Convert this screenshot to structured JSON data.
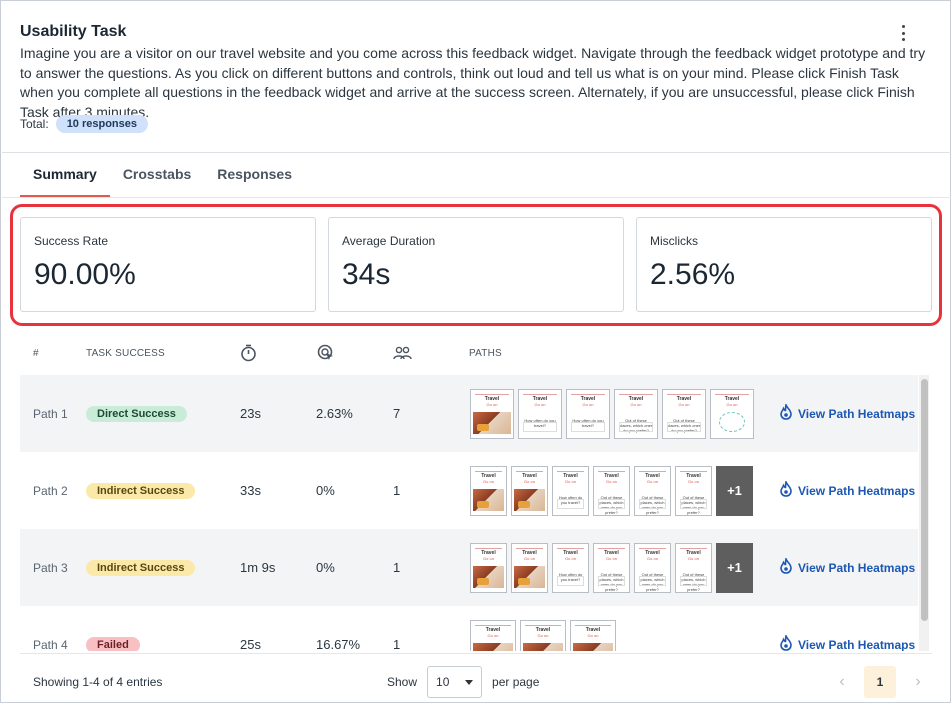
{
  "task": {
    "title": "Usability Task",
    "description": "Imagine you are a visitor on our travel website and you come across this feedback widget. Navigate through the feedback widget prototype and try to answer the questions. As you click on different buttons and controls, think out loud and tell us what is on your mind. Please click Finish Task when you complete all questions in the feedback widget and arrive at the success screen. Alternately, if you are unsuccessful, please click Finish Task after 3 minutes.",
    "total_label": "Total:",
    "responses_badge": "10 responses"
  },
  "tabs": [
    "Summary",
    "Crosstabs",
    "Responses"
  ],
  "active_tab": "Summary",
  "metrics": [
    {
      "label": "Success Rate",
      "value": "90.00%"
    },
    {
      "label": "Average Duration",
      "value": "34s"
    },
    {
      "label": "Misclicks",
      "value": "2.56%"
    }
  ],
  "table": {
    "headers": {
      "index": "#",
      "task_success": "TASK SUCCESS",
      "paths": "PATHS"
    },
    "header_icons": [
      "stopwatch-icon",
      "misclick-cursor-icon",
      "users-icon"
    ],
    "heatmap_label": "View Path Heatmaps",
    "thumb_text": {
      "title": "Travel",
      "sub": "Go on",
      "question1": "How often do you travel?",
      "question2": "Out of these places, which ones do you prefer?",
      "more": "+1"
    },
    "rows": [
      {
        "path": "Path 1",
        "status": "Direct Success",
        "kind": "direct",
        "duration": "23s",
        "misclicks": "2.63%",
        "users": "7"
      },
      {
        "path": "Path 2",
        "status": "Indirect Success",
        "kind": "indirect",
        "duration": "33s",
        "misclicks": "0%",
        "users": "1"
      },
      {
        "path": "Path 3",
        "status": "Indirect Success",
        "kind": "indirect",
        "duration": "1m 9s",
        "misclicks": "0%",
        "users": "1"
      },
      {
        "path": "Path 4",
        "status": "Failed",
        "kind": "failed",
        "duration": "25s",
        "misclicks": "16.67%",
        "users": "1"
      }
    ]
  },
  "footer": {
    "showing": "Showing 1-4 of 4 entries",
    "show_label": "Show",
    "page_size": "10",
    "per_page": "per page",
    "current_page": "1"
  },
  "colors": {
    "accent_tab": "#e05a4e",
    "highlight": "#e8333c",
    "link": "#1c57b3"
  }
}
